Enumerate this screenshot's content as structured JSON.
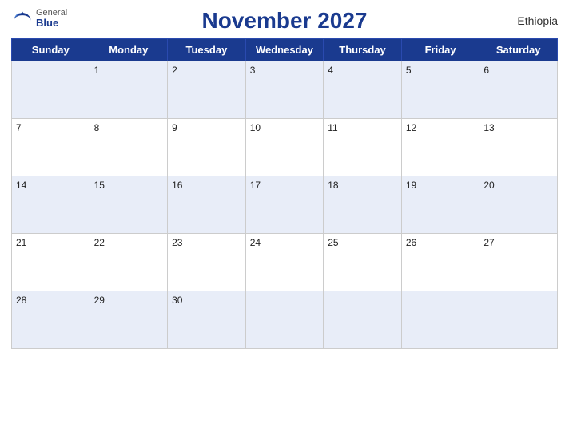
{
  "header": {
    "logo_general": "General",
    "logo_blue": "Blue",
    "title": "November 2027",
    "country": "Ethiopia"
  },
  "weekdays": [
    "Sunday",
    "Monday",
    "Tuesday",
    "Wednesday",
    "Thursday",
    "Friday",
    "Saturday"
  ],
  "weeks": [
    [
      null,
      1,
      2,
      3,
      4,
      5,
      6
    ],
    [
      7,
      8,
      9,
      10,
      11,
      12,
      13
    ],
    [
      14,
      15,
      16,
      17,
      18,
      19,
      20
    ],
    [
      21,
      22,
      23,
      24,
      25,
      26,
      27
    ],
    [
      28,
      29,
      30,
      null,
      null,
      null,
      null
    ]
  ],
  "colors": {
    "header_bg": "#1a3a8f",
    "row_odd_bg": "#dce4f5",
    "row_even_bg": "#ffffff",
    "border": "#b0b8d0"
  }
}
